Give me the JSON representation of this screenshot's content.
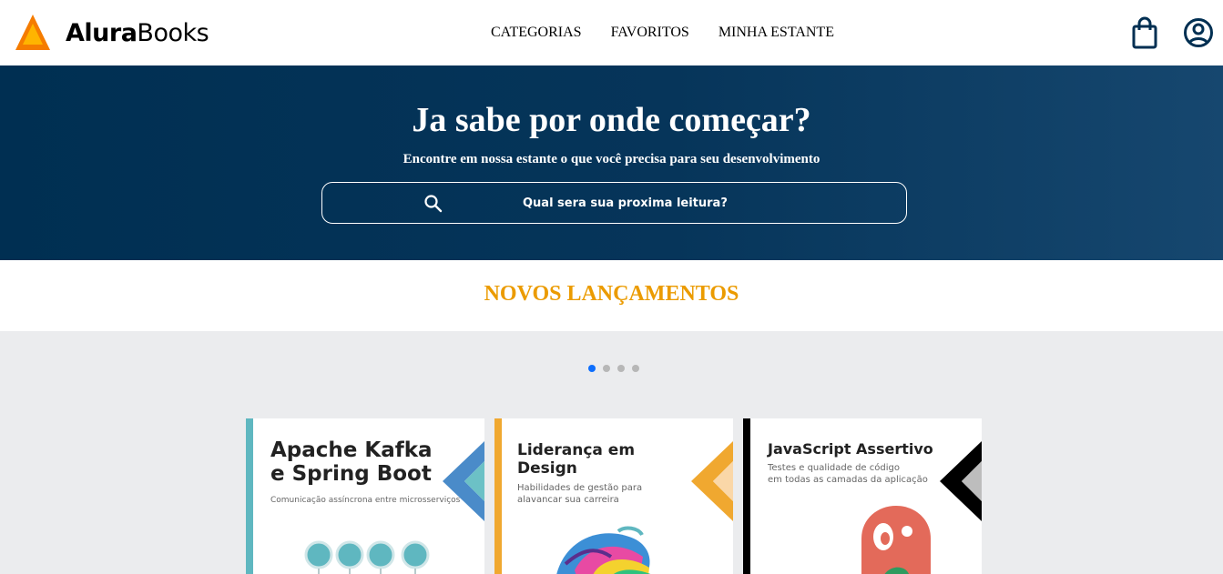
{
  "header": {
    "brand_bold": "Alura",
    "brand_regular": "Books",
    "nav": [
      "CATEGORIAS",
      "FAVORITOS",
      "MINHA ESTANTE"
    ],
    "icons": [
      "shopping-bag-icon",
      "user-account-icon"
    ]
  },
  "hero": {
    "title": "Ja sabe por onde começar?",
    "subtitle": "Encontre em nossa estante o que você precisa para seu desenvolvimento",
    "search_placeholder": "Qual sera sua proxima leitura?"
  },
  "section": {
    "title": "NOVOS LANÇAMENTOS"
  },
  "carousel": {
    "dots": 4,
    "active_dot": 0,
    "books": [
      {
        "title_line1": "Apache Kafka",
        "title_line2": "e Spring Boot",
        "subtitle_line1": "Comunicação assíncrona entre microsserviços",
        "subtitle_line2": "",
        "stripe_color": "#5fb7c0",
        "accent_color": "#4a8bc9"
      },
      {
        "title_line1": "Liderança em",
        "title_line2": "Design",
        "subtitle_line1": "Habilidades de gestão para",
        "subtitle_line2": "alavancar sua carreira",
        "stripe_color": "#f0a830",
        "accent_color": "#f0a830"
      },
      {
        "title_line1": "JavaScript Assertivo",
        "title_line2": "",
        "subtitle_line1": "Testes e qualidade de código",
        "subtitle_line2": "em todas as camadas da aplicação",
        "stripe_color": "#000000",
        "accent_color": "#000000"
      }
    ]
  },
  "colors": {
    "hero_dark": "#002f52",
    "hero_light": "#16476f",
    "accent_orange": "#eb9b00",
    "carousel_bg": "#ebecee",
    "dot_active": "#0d6efd"
  }
}
